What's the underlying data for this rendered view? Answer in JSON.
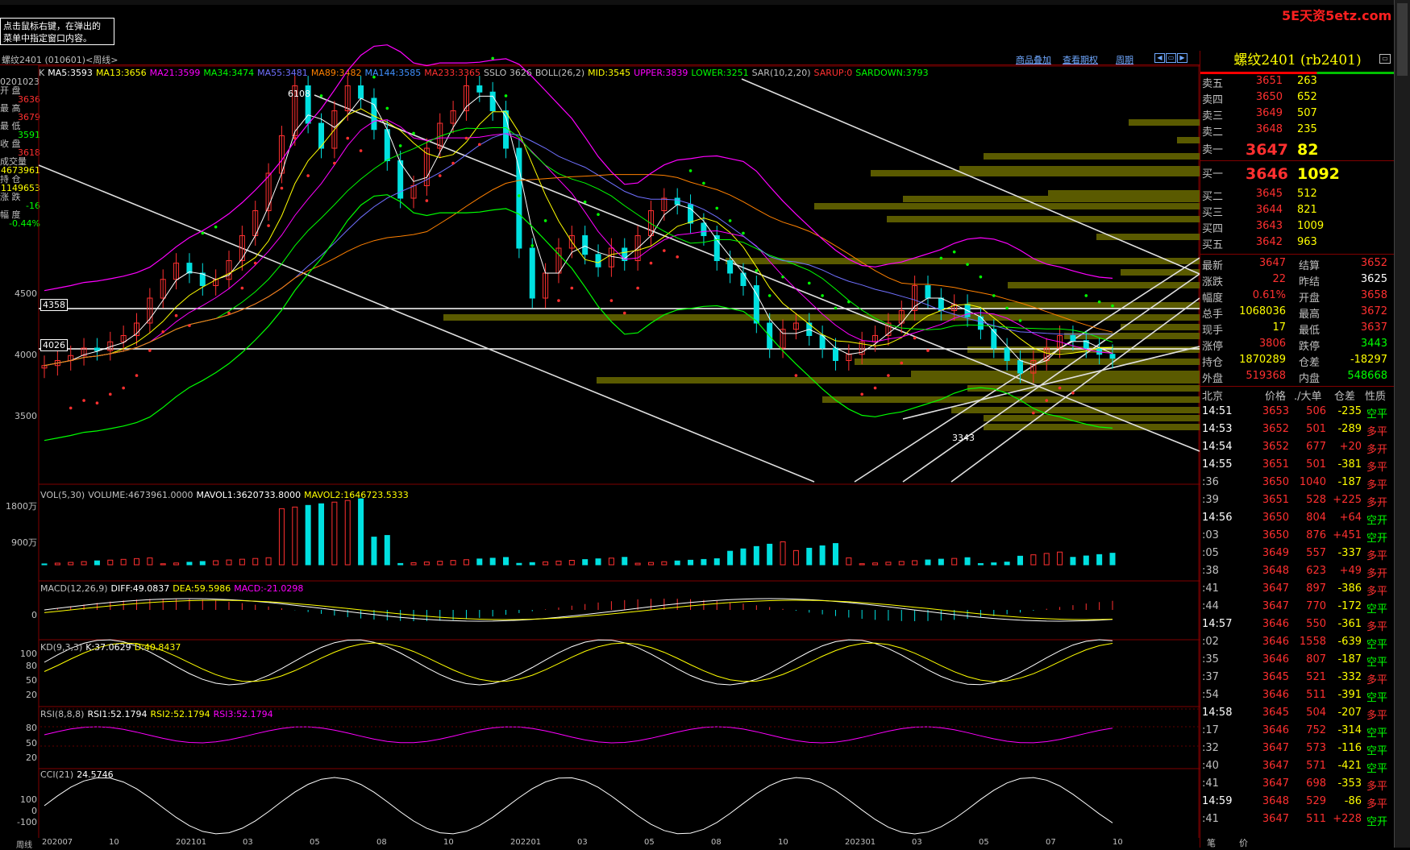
{
  "app": {
    "tip_line1": "点击鼠标右键，在弹出的",
    "tip_line2": "菜单中指定窗口内容。",
    "logo": "5E天资5etz.com",
    "chart_title": "螺纹2401 (010601)<周线>"
  },
  "toolbar": {
    "overlay": "商品叠加",
    "options": "查看期权",
    "period": "周期"
  },
  "price_inds": [
    "K",
    "MA5:3593",
    "MA13:3656",
    "MA21:3599",
    "MA34:3474",
    "MA55:3481",
    "MA89:3482",
    "MA144:3585",
    "MA233:3365",
    "SSLO 3626",
    "BOLL(26,2)",
    "MID:3545",
    "UPPER:3839",
    "LOWER:3251",
    "SAR(10,2,20)",
    "SARUP:0",
    "SARDOWN:3793"
  ],
  "colors": {
    "up": "#ff3030",
    "down": "#00e0e0",
    "ma5": "#ffffff",
    "ma13": "#ffff00",
    "ma21": "#ff00ff",
    "ma34": "#00ff00",
    "ma55": "#7070ff",
    "ma89": "#ff8000",
    "ma144": "#4090ff",
    "ma233": "#ff3030",
    "boll": "#ff00ff",
    "accent": "#ffff00",
    "green": "#00ff00",
    "red": "#ff3030",
    "cyan": "#00e0e0"
  },
  "leftinfo": [
    {
      "label": "0201023",
      "value": ""
    },
    {
      "label": "开 盘",
      "value": "3636"
    },
    {
      "label": "最 高",
      "value": "3679"
    },
    {
      "label": "最 低",
      "value": "3591"
    },
    {
      "label": "收 盘",
      "value": "3618"
    },
    {
      "label": "成交量",
      "value": "4673961"
    },
    {
      "label": "持 仓",
      "value": "1149653"
    },
    {
      "label": "涨 跌",
      "value": "-16"
    },
    {
      "label": "幅 度",
      "value": "-0.44%"
    }
  ],
  "price_axis": [
    "4500",
    "4000",
    "3500"
  ],
  "price_marks": {
    "high": "6108",
    "low": "3343",
    "level1": "4358",
    "level2": "4026"
  },
  "chart_data": {
    "type": "candlestick",
    "x_ticks": [
      "202007",
      "10",
      "202101",
      "03",
      "05",
      "08",
      "10",
      "202201",
      "03",
      "05",
      "08",
      "10",
      "202301",
      "03",
      "05",
      "07",
      "10"
    ],
    "candles_note": "weekly OHLC",
    "closes": [
      3560,
      3600,
      3640,
      3700,
      3680,
      3750,
      3800,
      3900,
      4100,
      4250,
      4380,
      4300,
      4200,
      4250,
      4400,
      4600,
      4800,
      5100,
      5400,
      5800,
      5500,
      5300,
      5600,
      5800,
      5700,
      5450,
      5200,
      4900,
      5000,
      5300,
      5500,
      5600,
      5800,
      5750,
      5600,
      5300,
      4500,
      4100,
      4300,
      4500,
      4600,
      4450,
      4350,
      4500,
      4400,
      4600,
      4800,
      4900,
      4850,
      4700,
      4600,
      4400,
      4300,
      4200,
      3900,
      3700,
      3850,
      3900,
      3800,
      3700,
      3600,
      3650,
      3750,
      3800,
      3900,
      4000,
      4200,
      4100,
      4000,
      4050,
      3950,
      3850,
      3700,
      3600,
      3500,
      3600,
      3700,
      3800,
      3760,
      3700,
      3650,
      3618
    ],
    "volume_axis": [
      "1800万",
      "900万"
    ],
    "volume": {
      "label": "VOL(5,30)",
      "VOLUME": "VOLUME:4673961.0000",
      "MAVOL1": "MAVOL1:3620733.8000",
      "MAVOL2": "MAVOL2:1646723.5333"
    },
    "macd": {
      "label": "MACD(12,26,9)",
      "DIFF": "DIFF:49.0837",
      "DEA": "DEA:59.5986",
      "MACD": "MACD:-21.0298",
      "axis": [
        "0"
      ]
    },
    "kd": {
      "label": "KD(9,3,3)",
      "K": "K:37.0629",
      "D": "D:40.8437",
      "axis": [
        "100",
        "80",
        "50",
        "20"
      ]
    },
    "rsi": {
      "label": "RSI(8,8,8)",
      "RSI1": "RSI1:52.1794",
      "RSI2": "RSI2:52.1794",
      "RSI3": "RSI3:52.1794",
      "axis": [
        "80",
        "50",
        "20"
      ]
    },
    "cci": {
      "label": "CCI(21)",
      "value": "24.5746",
      "axis": [
        "100",
        "0",
        "-100"
      ]
    }
  },
  "quote": {
    "name": "螺纹2401 (rb2401)",
    "asks": [
      {
        "l": "卖五",
        "p": "3651",
        "v": "263"
      },
      {
        "l": "卖四",
        "p": "3650",
        "v": "652"
      },
      {
        "l": "卖三",
        "p": "3649",
        "v": "507"
      },
      {
        "l": "卖二",
        "p": "3648",
        "v": "235"
      },
      {
        "l": "卖一",
        "p": "3647",
        "v": "82"
      }
    ],
    "bids": [
      {
        "l": "买一",
        "p": "3646",
        "v": "1092"
      },
      {
        "l": "买二",
        "p": "3645",
        "v": "512"
      },
      {
        "l": "买三",
        "p": "3644",
        "v": "821"
      },
      {
        "l": "买四",
        "p": "3643",
        "v": "1009"
      },
      {
        "l": "买五",
        "p": "3642",
        "v": "963"
      }
    ],
    "stats": [
      {
        "l1": "最新",
        "v1": "3647",
        "l2": "结算",
        "v2": "3652",
        "c1": "#ff3030",
        "c2": "#ff3030"
      },
      {
        "l1": "涨跌",
        "v1": "22",
        "l2": "昨结",
        "v2": "3625",
        "c1": "#ff3030",
        "c2": "#ffffff"
      },
      {
        "l1": "幅度",
        "v1": "0.61%",
        "l2": "开盘",
        "v2": "3658",
        "c1": "#ff3030",
        "c2": "#ff3030"
      },
      {
        "l1": "总手",
        "v1": "1068036",
        "l2": "最高",
        "v2": "3672",
        "c1": "#ffff00",
        "c2": "#ff3030"
      },
      {
        "l1": "现手",
        "v1": "17",
        "l2": "最低",
        "v2": "3637",
        "c1": "#ffff00",
        "c2": "#ff3030"
      },
      {
        "l1": "涨停",
        "v1": "3806",
        "l2": "跌停",
        "v2": "3443",
        "c1": "#ff3030",
        "c2": "#00ff00"
      },
      {
        "l1": "持仓",
        "v1": "1870289",
        "l2": "仓差",
        "v2": "-18297",
        "c1": "#ffff00",
        "c2": "#ffff00"
      },
      {
        "l1": "外盘",
        "v1": "519368",
        "l2": "内盘",
        "v2": "548668",
        "c1": "#ff3030",
        "c2": "#00ff00"
      }
    ],
    "tick_head": {
      "time": "北京",
      "price": "价格",
      "vol": "./大单",
      "oi": "仓差",
      "nature": "性质"
    },
    "ticks": [
      {
        "t": "14:51",
        "p": "3653",
        "v": "506",
        "d": "-235",
        "n": "空平",
        "big": true
      },
      {
        "t": "14:53",
        "p": "3652",
        "v": "501",
        "d": "-289",
        "n": "多平",
        "big": true
      },
      {
        "t": "14:54",
        "p": "3652",
        "v": "677",
        "d": "+20",
        "n": "多开",
        "big": true
      },
      {
        "t": "14:55",
        "p": "3651",
        "v": "501",
        "d": "-381",
        "n": "多平",
        "big": true
      },
      {
        "t": ":36",
        "p": "3650",
        "v": "1040",
        "d": "-187",
        "n": "多平",
        "big": false
      },
      {
        "t": ":39",
        "p": "3651",
        "v": "528",
        "d": "+225",
        "n": "多开",
        "big": false
      },
      {
        "t": "14:56",
        "p": "3650",
        "v": "804",
        "d": "+64",
        "n": "空开",
        "big": true
      },
      {
        "t": ":03",
        "p": "3650",
        "v": "876",
        "d": "+451",
        "n": "空开",
        "big": false
      },
      {
        "t": ":05",
        "p": "3649",
        "v": "557",
        "d": "-337",
        "n": "多平",
        "big": false
      },
      {
        "t": ":38",
        "p": "3648",
        "v": "623",
        "d": "+49",
        "n": "多开",
        "big": false
      },
      {
        "t": ":41",
        "p": "3647",
        "v": "897",
        "d": "-386",
        "n": "多平",
        "big": false
      },
      {
        "t": ":44",
        "p": "3647",
        "v": "770",
        "d": "-172",
        "n": "空平",
        "big": false
      },
      {
        "t": "14:57",
        "p": "3646",
        "v": "550",
        "d": "-361",
        "n": "多平",
        "big": true
      },
      {
        "t": ":02",
        "p": "3646",
        "v": "1558",
        "d": "-639",
        "n": "空平",
        "big": false
      },
      {
        "t": ":35",
        "p": "3646",
        "v": "807",
        "d": "-187",
        "n": "空平",
        "big": false
      },
      {
        "t": ":37",
        "p": "3645",
        "v": "521",
        "d": "-332",
        "n": "多平",
        "big": false
      },
      {
        "t": ":54",
        "p": "3646",
        "v": "511",
        "d": "-391",
        "n": "空平",
        "big": false
      },
      {
        "t": "14:58",
        "p": "3645",
        "v": "504",
        "d": "-207",
        "n": "多平",
        "big": true
      },
      {
        "t": ":17",
        "p": "3646",
        "v": "752",
        "d": "-314",
        "n": "空平",
        "big": false
      },
      {
        "t": ":32",
        "p": "3647",
        "v": "573",
        "d": "-116",
        "n": "空平",
        "big": false
      },
      {
        "t": ":40",
        "p": "3647",
        "v": "571",
        "d": "-421",
        "n": "空平",
        "big": false
      },
      {
        "t": ":41",
        "p": "3647",
        "v": "698",
        "d": "-353",
        "n": "多平",
        "big": false
      },
      {
        "t": "14:59",
        "p": "3648",
        "v": "529",
        "d": "-86",
        "n": "多平",
        "big": true
      },
      {
        "t": ":41",
        "p": "3647",
        "v": "511",
        "d": "+228",
        "n": "空开",
        "big": false
      }
    ],
    "bottom_tabs": [
      "笔",
      "价"
    ]
  },
  "xaxis_label": "周线"
}
